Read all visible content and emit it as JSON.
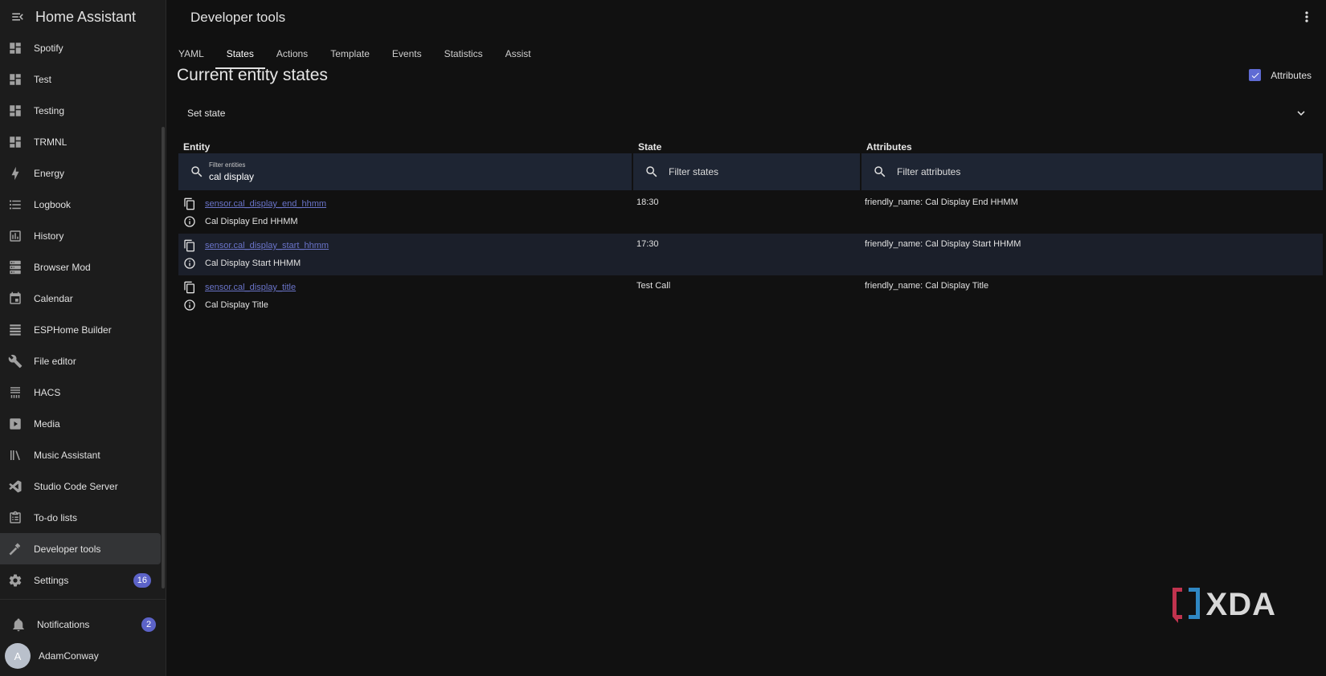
{
  "app": {
    "title": "Home Assistant"
  },
  "sidebar": {
    "items": [
      {
        "label": "Spotify",
        "icon": "dashboard-icon"
      },
      {
        "label": "Test",
        "icon": "dashboard-icon"
      },
      {
        "label": "Testing",
        "icon": "dashboard-icon"
      },
      {
        "label": "TRMNL",
        "icon": "dashboard-icon"
      },
      {
        "label": "Energy",
        "icon": "lightning-bolt-icon"
      },
      {
        "label": "Logbook",
        "icon": "format-list-icon"
      },
      {
        "label": "History",
        "icon": "chart-box-icon"
      },
      {
        "label": "Browser Mod",
        "icon": "server-icon"
      },
      {
        "label": "Calendar",
        "icon": "calendar-icon"
      },
      {
        "label": "ESPHome Builder",
        "icon": "esphome-icon"
      },
      {
        "label": "File editor",
        "icon": "wrench-icon"
      },
      {
        "label": "HACS",
        "icon": "hacs-icon"
      },
      {
        "label": "Media",
        "icon": "play-box-icon"
      },
      {
        "label": "Music Assistant",
        "icon": "music-library-icon"
      },
      {
        "label": "Studio Code Server",
        "icon": "vscode-icon"
      },
      {
        "label": "To-do lists",
        "icon": "clipboard-list-icon"
      },
      {
        "label": "Developer tools",
        "icon": "hammer-icon",
        "active": true
      },
      {
        "label": "Settings",
        "icon": "gear-icon",
        "badge": "16"
      }
    ],
    "notifications": {
      "label": "Notifications",
      "badge": "2"
    },
    "user": {
      "name": "AdamConway",
      "initial": "A"
    }
  },
  "header": {
    "title": "Developer tools"
  },
  "tabs": [
    {
      "label": "YAML"
    },
    {
      "label": "States",
      "active": true
    },
    {
      "label": "Actions"
    },
    {
      "label": "Template"
    },
    {
      "label": "Events"
    },
    {
      "label": "Statistics"
    },
    {
      "label": "Assist"
    }
  ],
  "main": {
    "section_title": "Current entity states",
    "attributes_toggle": {
      "label": "Attributes",
      "checked": true
    },
    "set_state": {
      "label": "Set state"
    },
    "columns": {
      "entity": "Entity",
      "state": "State",
      "attributes": "Attributes"
    },
    "filters": {
      "entity": {
        "label": "Filter entities",
        "value": "cal display"
      },
      "state": {
        "placeholder": "Filter states"
      },
      "attributes": {
        "placeholder": "Filter attributes"
      }
    },
    "rows": [
      {
        "entity_id": "sensor.cal_display_end_hhmm",
        "name": "Cal Display End HHMM",
        "state": "18:30",
        "attributes": "friendly_name: Cal Display End HHMM"
      },
      {
        "entity_id": "sensor.cal_display_start_hhmm",
        "name": "Cal Display Start HHMM",
        "state": "17:30",
        "attributes": "friendly_name: Cal Display Start HHMM"
      },
      {
        "entity_id": "sensor.cal_display_title",
        "name": "Cal Display Title",
        "state": "Test Call",
        "attributes": "friendly_name: Cal Display Title"
      }
    ]
  },
  "watermark": {
    "text": "XDA"
  },
  "colors": {
    "accent": "#5f6bd4",
    "link": "#6a74c9",
    "badge": "#5c63c8",
    "background": "#111111",
    "sidebar": "#1c1c1c",
    "row_alt": "#1b1f2a"
  }
}
